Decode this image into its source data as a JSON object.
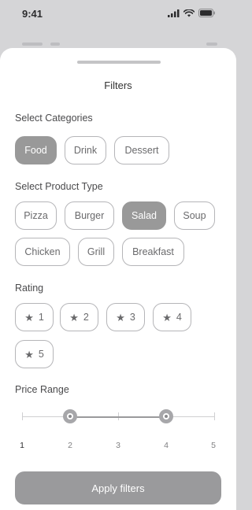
{
  "status_bar": {
    "time": "9:41"
  },
  "sheet": {
    "title": "Filters"
  },
  "categories": {
    "title": "Select Categories",
    "items": [
      {
        "label": "Food",
        "selected": true
      },
      {
        "label": "Drink",
        "selected": false
      },
      {
        "label": "Dessert",
        "selected": false
      }
    ]
  },
  "product_type": {
    "title": "Select Product Type",
    "items": [
      {
        "label": "Pizza",
        "selected": false
      },
      {
        "label": "Burger",
        "selected": false
      },
      {
        "label": "Salad",
        "selected": true
      },
      {
        "label": "Soup",
        "selected": false
      },
      {
        "label": "Chicken",
        "selected": false
      },
      {
        "label": "Grill",
        "selected": false
      },
      {
        "label": "Breakfast",
        "selected": false
      }
    ]
  },
  "rating": {
    "title": "Rating",
    "star_icon": "star-icon",
    "items": [
      {
        "label": "1"
      },
      {
        "label": "2"
      },
      {
        "label": "3"
      },
      {
        "label": "4"
      },
      {
        "label": "5"
      }
    ]
  },
  "price_range": {
    "title": "Price Range",
    "ticks": [
      "1",
      "2",
      "3",
      "4",
      "5"
    ],
    "selected_min": "2",
    "selected_max": "4"
  },
  "apply_button": {
    "label": "Apply filters"
  },
  "colors": {
    "selected_chip": "#999999",
    "apply_button": "#9a9a9c",
    "sheet_background": "#ffffff",
    "backdrop": "#d5d5d7"
  }
}
